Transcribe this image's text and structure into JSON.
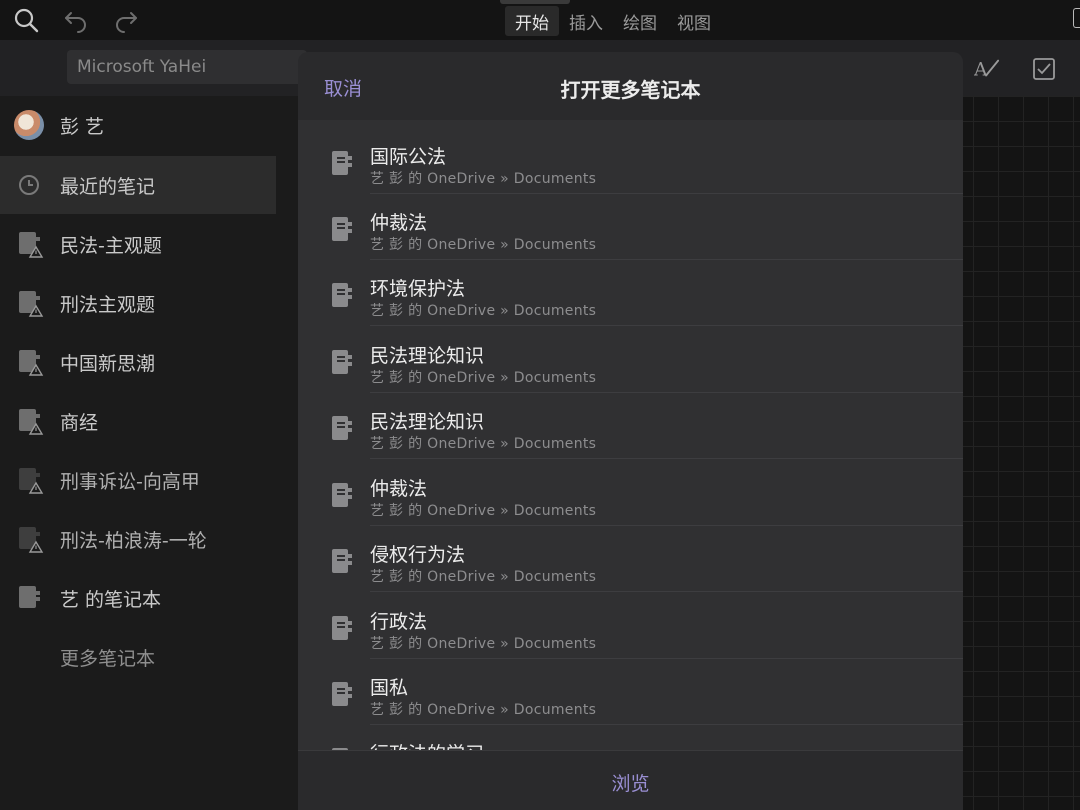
{
  "topbar": {
    "tabs": [
      {
        "label": "开始",
        "active": true
      },
      {
        "label": "插入",
        "active": false
      },
      {
        "label": "绘图",
        "active": false
      },
      {
        "label": "视图",
        "active": false
      }
    ]
  },
  "ribbon": {
    "font_name": "Microsoft YaHei"
  },
  "sidebar": {
    "user_name": "彭 艺",
    "items": [
      {
        "label": "最近的笔记",
        "icon": "clock-icon",
        "selected": true
      },
      {
        "label": "民法-主观题",
        "icon": "notebook-warning-icon"
      },
      {
        "label": "刑法主观题",
        "icon": "notebook-warning-icon"
      },
      {
        "label": "中国新思潮",
        "icon": "notebook-warning-icon"
      },
      {
        "label": "商经",
        "icon": "notebook-warning-icon"
      },
      {
        "label": "刑事诉讼-向高甲",
        "icon": "notebook-warning-icon"
      },
      {
        "label": "刑法-柏浪涛-一轮",
        "icon": "notebook-warning-icon"
      },
      {
        "label": "艺 的笔记本",
        "icon": "notebook-icon"
      }
    ],
    "more_label": "更多笔记本"
  },
  "modal": {
    "cancel_label": "取消",
    "title": "打开更多笔记本",
    "browse_label": "浏览",
    "notebooks": [
      {
        "name": "国际公法",
        "path": "艺 彭 的 OneDrive » Documents"
      },
      {
        "name": "仲裁法",
        "path": "艺 彭 的 OneDrive » Documents"
      },
      {
        "name": "环境保护法",
        "path": "艺 彭 的 OneDrive » Documents"
      },
      {
        "name": "民法理论知识",
        "path": "艺 彭 的 OneDrive » Documents"
      },
      {
        "name": "民法理论知识",
        "path": "艺 彭 的 OneDrive » Documents"
      },
      {
        "name": "仲裁法",
        "path": "艺 彭 的 OneDrive » Documents"
      },
      {
        "name": "侵权行为法",
        "path": "艺 彭 的 OneDrive » Documents"
      },
      {
        "name": "行政法",
        "path": "艺 彭 的 OneDrive » Documents"
      },
      {
        "name": "国私",
        "path": "艺 彭 的 OneDrive » Documents"
      },
      {
        "name": "行政法的学习",
        "path": ""
      }
    ]
  },
  "colors": {
    "accent": "#9a8fd4",
    "modal_bg": "#2a2a2c",
    "list_bg": "#303032",
    "sidebar_bg": "#1b1b1b"
  }
}
